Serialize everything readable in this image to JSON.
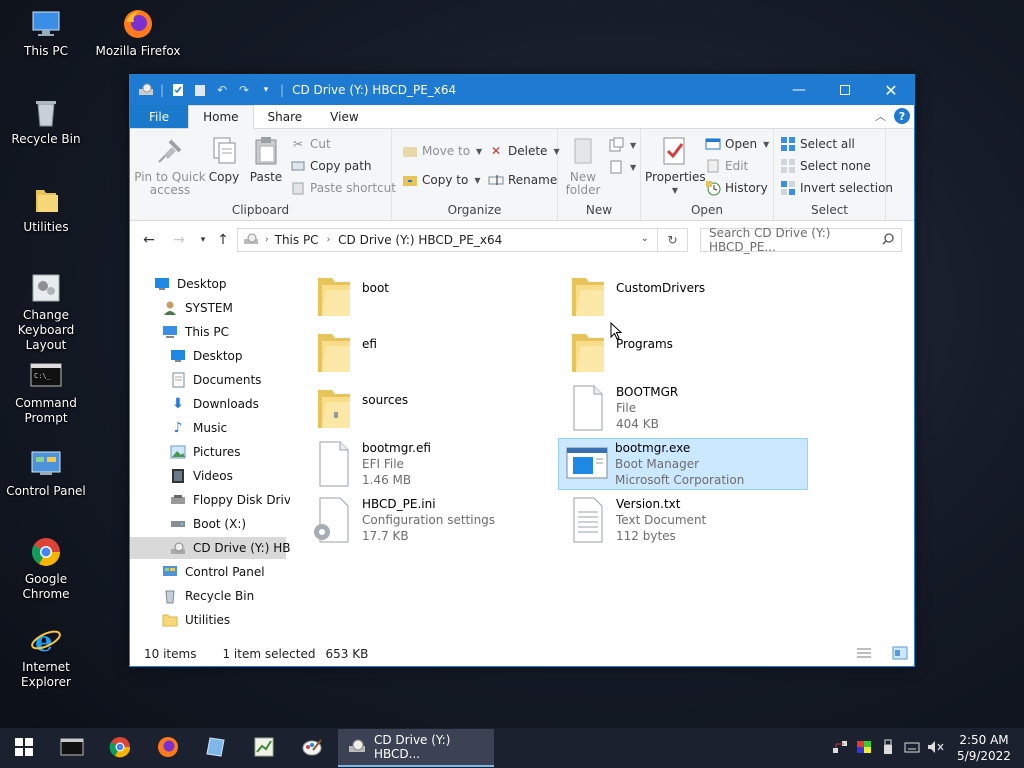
{
  "desktop": {
    "icons": [
      {
        "label": "This PC",
        "icon": "this-pc-icon"
      },
      {
        "label": "Mozilla Firefox",
        "icon": "firefox-icon"
      },
      {
        "label": "Recycle Bin",
        "icon": "recycle-bin-icon"
      },
      {
        "label": "Utilities",
        "icon": "folder-icon"
      },
      {
        "label_line1": "Change",
        "label_line2": "Keyboard Layout",
        "icon": "keyboard-icon"
      },
      {
        "label_line1": "Command",
        "label_line2": "Prompt",
        "icon": "cmd-icon"
      },
      {
        "label": "Control Panel",
        "icon": "control-panel-icon"
      },
      {
        "label": "Google Chrome",
        "icon": "chrome-icon"
      },
      {
        "label": "Internet Explorer",
        "icon": "ie-icon"
      }
    ]
  },
  "window": {
    "title": "CD Drive (Y:) HBCD_PE_x64",
    "accent": "#1f7ad2",
    "tabs": {
      "file": "File",
      "home": "Home",
      "share": "Share",
      "view": "View"
    },
    "ribbon": {
      "clipboard": {
        "label": "Clipboard",
        "pin_line1": "Pin to Quick",
        "pin_line2": "access",
        "copy": "Copy",
        "paste": "Paste",
        "cut": "Cut",
        "copy_path": "Copy path",
        "paste_shortcut": "Paste shortcut"
      },
      "organize": {
        "label": "Organize",
        "move_to": "Move to",
        "copy_to": "Copy to",
        "delete": "Delete",
        "rename": "Rename"
      },
      "new": {
        "label": "New",
        "new_folder_line1": "New",
        "new_folder_line2": "folder"
      },
      "open": {
        "label": "Open",
        "properties": "Properties",
        "open": "Open",
        "edit": "Edit",
        "history": "History"
      },
      "select": {
        "label": "Select",
        "select_all": "Select all",
        "select_none": "Select none",
        "invert": "Invert selection"
      }
    },
    "address": {
      "crumbs": [
        "This PC",
        "CD Drive (Y:) HBCD_PE_x64"
      ],
      "search_placeholder": "Search CD Drive (Y:) HBCD_PE..."
    },
    "nav": [
      {
        "label": "Desktop",
        "icon": "desktop-icon",
        "level": 0
      },
      {
        "label": "SYSTEM",
        "icon": "user-icon",
        "level": 1
      },
      {
        "label": "This PC",
        "icon": "this-pc-icon",
        "level": 1
      },
      {
        "label": "Desktop",
        "icon": "desktop-icon",
        "level": 2
      },
      {
        "label": "Documents",
        "icon": "documents-icon",
        "level": 2
      },
      {
        "label": "Downloads",
        "icon": "downloads-icon",
        "level": 2
      },
      {
        "label": "Music",
        "icon": "music-icon",
        "level": 2
      },
      {
        "label": "Pictures",
        "icon": "pictures-icon",
        "level": 2
      },
      {
        "label": "Videos",
        "icon": "videos-icon",
        "level": 2
      },
      {
        "label": "Floppy Disk Drive",
        "icon": "floppy-icon",
        "level": 2
      },
      {
        "label": "Boot (X:)",
        "icon": "drive-icon",
        "level": 2
      },
      {
        "label": "CD Drive (Y:) HBC",
        "icon": "cd-drive-icon",
        "level": 2,
        "selected": true
      },
      {
        "label": "Control Panel",
        "icon": "control-panel-icon",
        "level": 1
      },
      {
        "label": "Recycle Bin",
        "icon": "recycle-bin-icon",
        "level": 1
      },
      {
        "label": "Utilities",
        "icon": "folder-icon",
        "level": 1
      }
    ],
    "files": [
      {
        "name": "boot",
        "type": "folder"
      },
      {
        "name": "CustomDrivers",
        "type": "folder"
      },
      {
        "name": "efi",
        "type": "folder"
      },
      {
        "name": "Programs",
        "type": "folder"
      },
      {
        "name": "sources",
        "type": "folder"
      },
      {
        "name": "BOOTMGR",
        "sub1": "File",
        "sub2": "404 KB",
        "type": "file"
      },
      {
        "name": "bootmgr.efi",
        "sub1": "EFI File",
        "sub2": "1.46 MB",
        "type": "file"
      },
      {
        "name": "bootmgr.exe",
        "sub1": "Boot Manager",
        "sub2": "Microsoft Corporation",
        "type": "exe",
        "selected": true
      },
      {
        "name": "HBCD_PE.ini",
        "sub1": "Configuration settings",
        "sub2": "17.7 KB",
        "type": "ini"
      },
      {
        "name": "Version.txt",
        "sub1": "Text Document",
        "sub2": "112 bytes",
        "type": "txt"
      }
    ],
    "status": {
      "count": "10 items",
      "selected": "1 item selected",
      "size": "653 KB"
    }
  },
  "taskbar": {
    "window_label": "CD Drive (Y:) HBCD...",
    "time": "2:50 AM",
    "date": "5/9/2022"
  }
}
